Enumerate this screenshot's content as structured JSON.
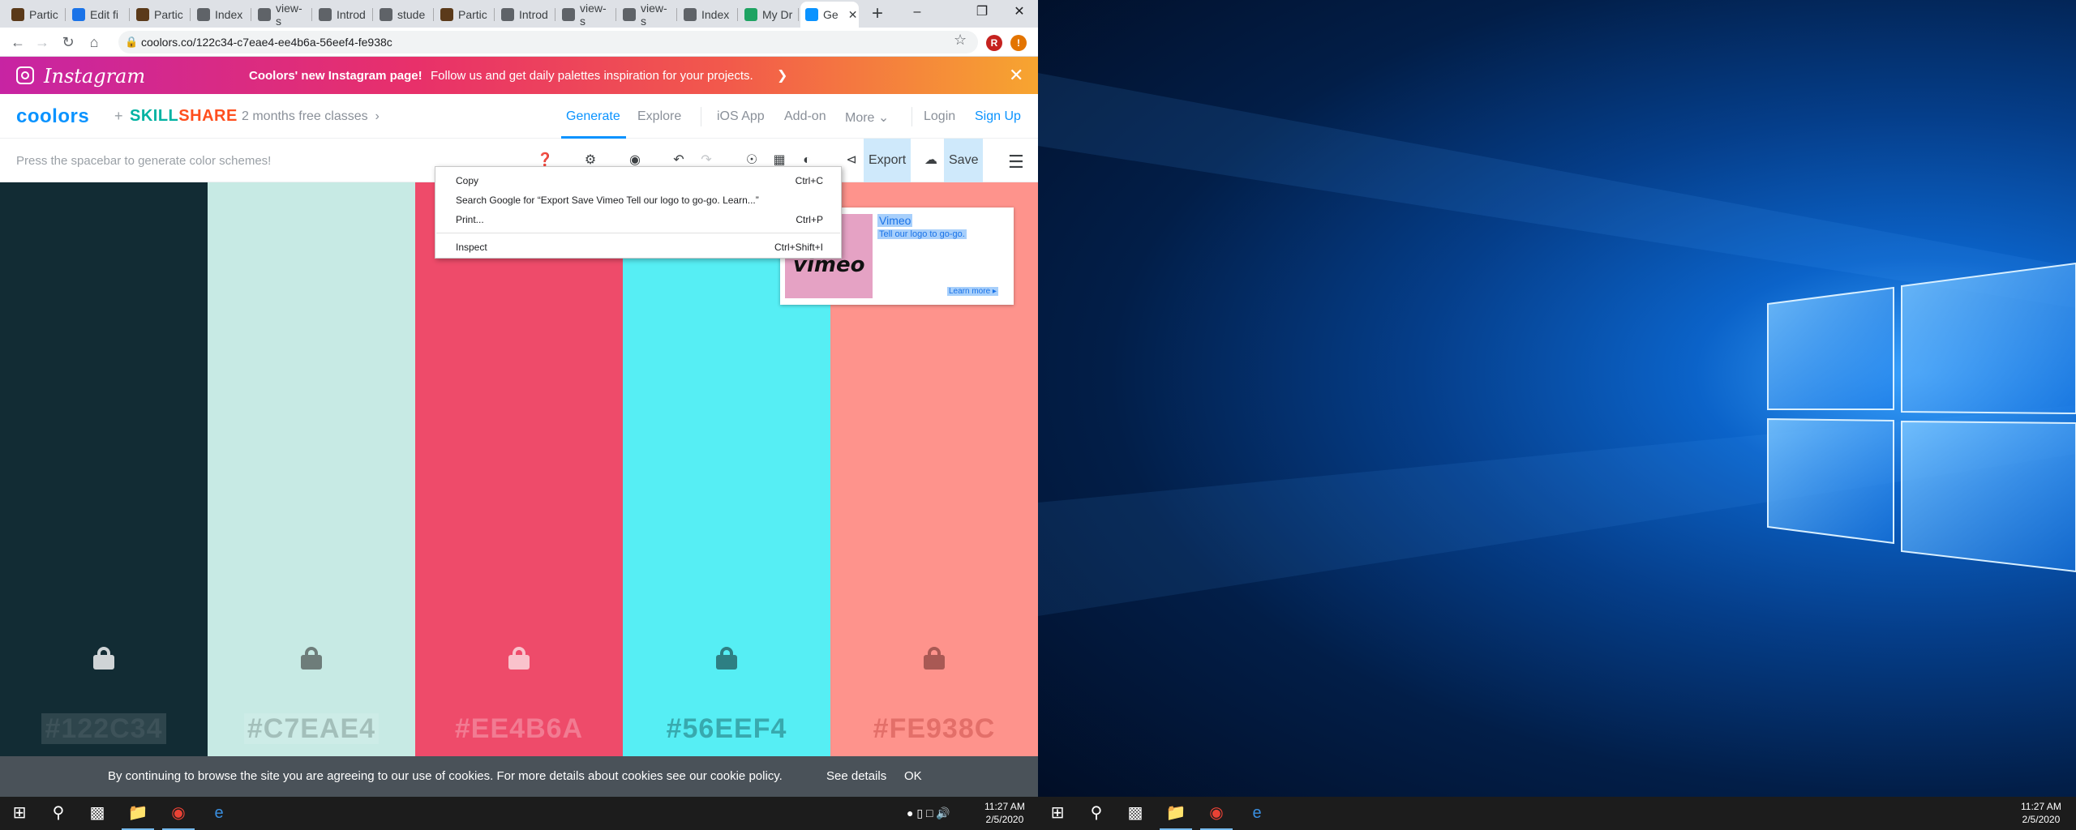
{
  "browser": {
    "tabs": [
      {
        "label": "Partic",
        "favicon_color": "#5b3a1a"
      },
      {
        "label": "Edit fi",
        "favicon_color": "#1a73e8"
      },
      {
        "label": "Partic",
        "favicon_color": "#5b3a1a"
      },
      {
        "label": "Index",
        "favicon_color": "#5f6368"
      },
      {
        "label": "view-s",
        "favicon_color": "#5f6368"
      },
      {
        "label": "Introd",
        "favicon_color": "#5f6368"
      },
      {
        "label": "stude",
        "favicon_color": "#5f6368"
      },
      {
        "label": "Partic",
        "favicon_color": "#5b3a1a"
      },
      {
        "label": "Introd",
        "favicon_color": "#5f6368"
      },
      {
        "label": "view-s",
        "favicon_color": "#5f6368"
      },
      {
        "label": "view-s",
        "favicon_color": "#5f6368"
      },
      {
        "label": "Index",
        "favicon_color": "#5f6368"
      },
      {
        "label": "My Dr",
        "favicon_color": "#1ea362"
      },
      {
        "label": "Ge",
        "favicon_color": "#0a93ff",
        "active": true
      }
    ],
    "url": "coolors.co/122c34-c7eae4-ee4b6a-56eef4-fe938c",
    "profile_initial": "R",
    "notification_badge": "!"
  },
  "promo": {
    "brand": "Instagram",
    "title": "Coolors' new Instagram page!",
    "text": "Follow us and get daily palettes inspiration for your projects."
  },
  "nav": {
    "logo": "coolors",
    "plus": "+",
    "skillshare_a": "SKILL",
    "skillshare_b": "SHARE",
    "promo_text": "2 months free classes",
    "generate": "Generate",
    "explore": "Explore",
    "ios_app": "iOS App",
    "addon": "Add-on",
    "more": "More",
    "login": "Login",
    "signup": "Sign Up"
  },
  "toolbar": {
    "hint": "Press the spacebar to generate color schemes!",
    "export_label": "Export",
    "save_label": "Save"
  },
  "palette": [
    {
      "hex": "#122C34",
      "bg": "#122c34",
      "fg": "#3d5259",
      "lock": "#cfd4d6"
    },
    {
      "hex": "#C7EAE4",
      "bg": "#c7eae4",
      "fg": "#a3bfba",
      "lock": "#6e7d7a"
    },
    {
      "hex": "#EE4B6A",
      "bg": "#ee4b6a",
      "fg": "#f27b92",
      "lock": "#f9c2cc"
    },
    {
      "hex": "#56EEF4",
      "bg": "#56eef4",
      "fg": "#38a9ae",
      "lock": "#2e7f83"
    },
    {
      "hex": "#FE938C",
      "bg": "#fe938c",
      "fg": "#e36f69",
      "lock": "#a95954"
    }
  ],
  "cookie": {
    "message": "By continuing to browse the site you are agreeing to our use of cookies. For more details about cookies see our cookie policy.",
    "details": "See details",
    "ok": "OK"
  },
  "context_menu": {
    "copy": "Copy",
    "copy_key": "Ctrl+C",
    "search": "Search Google for “Export  Save Vimeo Tell our logo to go-go. Learn...”",
    "print": "Print...",
    "print_key": "Ctrl+P",
    "inspect": "Inspect",
    "inspect_key": "Ctrl+Shift+I"
  },
  "ad": {
    "thumb_text": "vimeo",
    "title": "Vimeo",
    "text": "Tell our logo to go-go.",
    "more": "Learn more"
  },
  "taskbar_left": {
    "time": "11:27 AM",
    "date": "2/5/2020"
  },
  "taskbar_right": {
    "time": "11:27 AM",
    "date": "2/5/2020"
  }
}
